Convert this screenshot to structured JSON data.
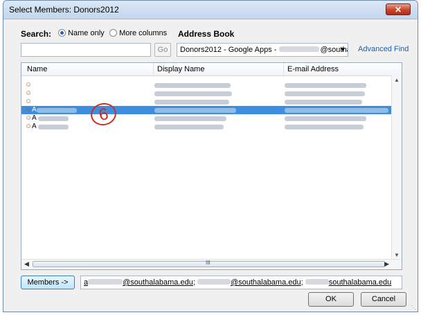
{
  "window": {
    "title": "Select Members: Donors2012",
    "close_glyph": "✕"
  },
  "search": {
    "label": "Search:",
    "option_name_only": "Name only",
    "option_more_columns": "More columns",
    "selected_option": "Name only",
    "input_value": "",
    "go_label": "Go"
  },
  "address_book": {
    "label": "Address Book",
    "selected_prefix": "Donors2012 - Google Apps - ",
    "selected_suffix": "@southa",
    "arrow": "▾",
    "advanced_find": "Advanced Find"
  },
  "list": {
    "columns": [
      "Name",
      "Display Name",
      "E-mail Address"
    ],
    "rows": [
      {
        "name": "",
        "selected": false
      },
      {
        "name": "",
        "selected": false
      },
      {
        "name": "",
        "selected": false
      },
      {
        "name": "A",
        "selected": true
      },
      {
        "name": "A",
        "selected": false
      },
      {
        "name": "A",
        "selected": false
      }
    ],
    "person_icon": "person-icon",
    "annotation": "6",
    "scroll_up": "▲",
    "scroll_down": "▼",
    "scroll_left": "◀",
    "scroll_right": "▶",
    "scroll_grip": "III"
  },
  "members": {
    "button_label": "Members ->",
    "entry1_prefix": "a",
    "entry1_suffix": "@southalabama.edu",
    "entry2_prefix": "; ",
    "entry2_suffix": "@southalabama.edu",
    "entry3_prefix": "; ",
    "entry3_suffix": "southalabama.edu"
  },
  "buttons": {
    "ok": "OK",
    "cancel": "Cancel"
  },
  "colors": {
    "selection": "#3c8fe0",
    "link": "#1f5fa8",
    "annotation": "#d22a22",
    "close": "#c8442a"
  }
}
